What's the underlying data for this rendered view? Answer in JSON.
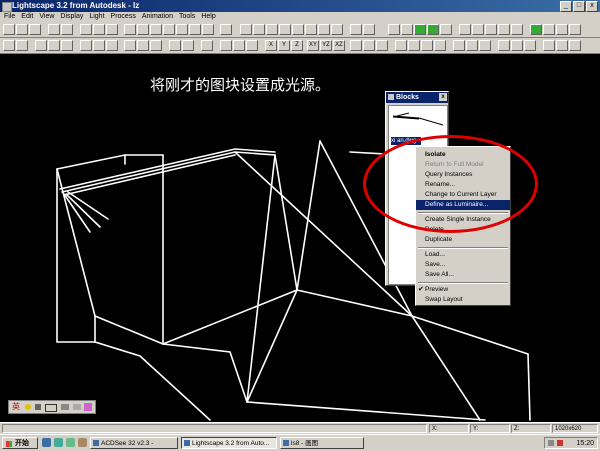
{
  "window": {
    "title": "Lightscape 3.2 from Autodesk - lz",
    "min": "_",
    "max": "□",
    "close": "x"
  },
  "menu": [
    "File",
    "Edit",
    "View",
    "Display",
    "Light",
    "Process",
    "Animation",
    "Tools",
    "Help"
  ],
  "toolbar2": {
    "xy": "XY",
    "yz": "YZ",
    "xz": "XZ",
    "x": "X",
    "y": "Y",
    "z": "Z"
  },
  "caption": "将刚才的图块设置成光源。",
  "blocks_panel": {
    "title": "Blocks",
    "close": "x",
    "selected_item": "xi an.dwg"
  },
  "context_menu": [
    {
      "label": "Isolate",
      "style": "bold"
    },
    {
      "label": "Return to Full Model",
      "style": "disabled"
    },
    {
      "label": "Query Instances"
    },
    {
      "label": "Rename..."
    },
    {
      "label": "Change to Current Layer"
    },
    {
      "label": "Define as Luminaire...",
      "style": "hl"
    },
    {
      "label": "Create Single Instance"
    },
    {
      "label": "Delete"
    },
    {
      "label": "Duplicate"
    },
    {
      "label": "Load..."
    },
    {
      "label": "Save..."
    },
    {
      "label": "Save All..."
    },
    {
      "label": "Preview",
      "checked": true
    },
    {
      "label": "Swap Layout"
    }
  ],
  "status": {
    "x": "X:",
    "y": "Y:",
    "z": "Z:",
    "resolution": "1020x620"
  },
  "ime_bar": "英",
  "taskbar": {
    "start": "开始",
    "tasks": [
      "ACDSee 32 v2.3 -",
      "Lightscape 3.2 from Auto...",
      "ls8 - 画图"
    ],
    "clock": "15:20"
  },
  "colors": {
    "highlight": "#0a246a",
    "annotation_circle": "#e00000",
    "viewport": "#000000",
    "wireframe": "#ffffff"
  }
}
